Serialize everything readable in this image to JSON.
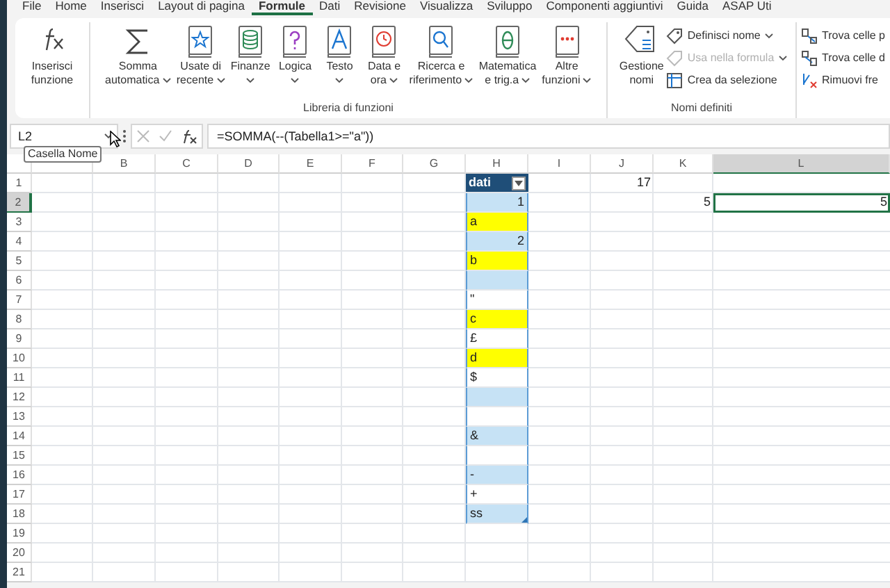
{
  "menu_tabs": [
    {
      "label": "File",
      "selected": false
    },
    {
      "label": "Home",
      "selected": false
    },
    {
      "label": "Inserisci",
      "selected": false
    },
    {
      "label": "Layout di pagina",
      "selected": false
    },
    {
      "label": "Formule",
      "selected": true
    },
    {
      "label": "Dati",
      "selected": false
    },
    {
      "label": "Revisione",
      "selected": false
    },
    {
      "label": "Visualizza",
      "selected": false
    },
    {
      "label": "Sviluppo",
      "selected": false
    },
    {
      "label": "Componenti aggiuntivi",
      "selected": false
    },
    {
      "label": "Guida",
      "selected": false
    },
    {
      "label": "ASAP Uti",
      "selected": false
    }
  ],
  "ribbon": {
    "insert_function": {
      "lines": [
        "Inserisci",
        "funzione"
      ]
    },
    "library": {
      "title": "Libreria di funzioni",
      "items": [
        {
          "kind": "sum",
          "lines": [
            "Somma",
            "automatica"
          ],
          "dropdown": true
        },
        {
          "kind": "recent",
          "lines": [
            "Usate di",
            "recente"
          ],
          "dropdown": true
        },
        {
          "kind": "finance",
          "lines": [
            "Finanze"
          ],
          "dropdown": true
        },
        {
          "kind": "logic",
          "lines": [
            "Logica"
          ],
          "dropdown": true
        },
        {
          "kind": "text",
          "lines": [
            "Testo"
          ],
          "dropdown": true
        },
        {
          "kind": "date",
          "lines": [
            "Data e",
            "ora"
          ],
          "dropdown": true
        },
        {
          "kind": "lookup",
          "lines": [
            "Ricerca e",
            "riferimento"
          ],
          "dropdown": true
        },
        {
          "kind": "math",
          "lines": [
            "Matematica",
            "e trig.a"
          ],
          "dropdown": true
        },
        {
          "kind": "more",
          "lines": [
            "Altre",
            "funzioni"
          ],
          "dropdown": true
        }
      ]
    },
    "names": {
      "title": "Nomi definiti",
      "manager": {
        "lines": [
          "Gestione",
          "nomi"
        ]
      },
      "commands": [
        {
          "kind": "tag",
          "label": "Definisci nome",
          "dropdown": true,
          "disabled": false
        },
        {
          "kind": "formula",
          "label": "Usa nella formula",
          "dropdown": true,
          "disabled": true
        },
        {
          "kind": "grid",
          "label": "Crea da selezione",
          "dropdown": false,
          "disabled": false
        }
      ]
    },
    "auditing": {
      "commands": [
        {
          "kind": "precedents",
          "label": "Trova celle p"
        },
        {
          "kind": "dependents",
          "label": "Trova celle d"
        },
        {
          "kind": "remove",
          "label": "Rimuovi fre"
        }
      ]
    }
  },
  "formula_bar": {
    "name_box": "L2",
    "formula": "=SOMMA(--(Tabella1>=\"a\"))",
    "tooltip": "Casella Nome"
  },
  "sheet": {
    "columns": [
      "B",
      "C",
      "D",
      "E",
      "F",
      "G",
      "H",
      "I",
      "J",
      "K",
      "L"
    ],
    "rows": [
      "1",
      "2",
      "3",
      "4",
      "5",
      "6",
      "7",
      "8",
      "9",
      "10",
      "11",
      "12",
      "13",
      "14",
      "15",
      "16",
      "17",
      "18",
      "19",
      "20",
      "21"
    ],
    "table": {
      "header": "dati",
      "values": [
        {
          "value": "1",
          "kind": "number",
          "highlight": false
        },
        {
          "value": "a",
          "kind": "text",
          "highlight": true
        },
        {
          "value": "2",
          "kind": "number",
          "highlight": false
        },
        {
          "value": "b",
          "kind": "text",
          "highlight": true
        },
        {
          "kind": "text",
          "highlight": false
        },
        {
          "value": "\"",
          "kind": "text",
          "highlight": false
        },
        {
          "value": "c",
          "kind": "text",
          "highlight": true
        },
        {
          "value": "£",
          "kind": "text",
          "highlight": false
        },
        {
          "value": "d",
          "kind": "text",
          "highlight": true
        },
        {
          "value": "$",
          "kind": "text",
          "highlight": false
        },
        {
          "kind": "text",
          "highlight": false
        },
        {
          "kind": "text",
          "highlight": false
        },
        {
          "value": "&",
          "kind": "text",
          "highlight": false
        },
        {
          "kind": "text",
          "highlight": false
        },
        {
          "value": "-",
          "kind": "text",
          "highlight": false
        },
        {
          "value": "+",
          "kind": "text",
          "highlight": false
        },
        {
          "value": "ss",
          "kind": "text",
          "highlight": false
        }
      ]
    },
    "cells": {
      "J1": {
        "value": "17",
        "selected": false
      },
      "K2": {
        "value": "5",
        "selected": false
      },
      "L2": {
        "value": "5",
        "selected": true
      }
    }
  }
}
